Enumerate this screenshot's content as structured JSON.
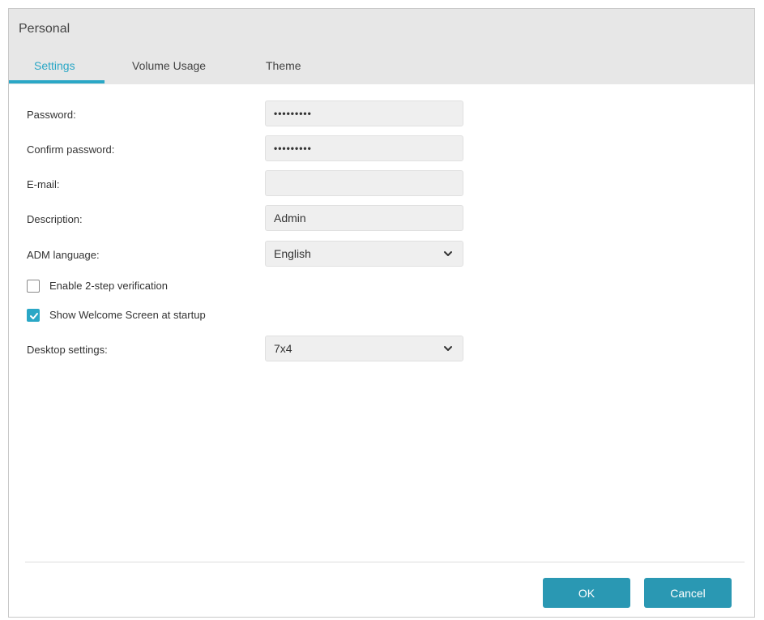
{
  "window": {
    "title": "Personal"
  },
  "tabs": [
    {
      "label": "Settings",
      "active": true
    },
    {
      "label": "Volume Usage",
      "active": false
    },
    {
      "label": "Theme",
      "active": false
    }
  ],
  "form": {
    "password": {
      "label": "Password:",
      "value": "•••••••••"
    },
    "confirm_password": {
      "label": "Confirm password:",
      "value": "•••••••••"
    },
    "email": {
      "label": "E-mail:",
      "value": ""
    },
    "description": {
      "label": "Description:",
      "value": "Admin"
    },
    "adm_language": {
      "label": "ADM language:",
      "value": "English"
    },
    "two_step": {
      "label": "Enable 2-step verification",
      "checked": false
    },
    "welcome_screen": {
      "label": "Show Welcome Screen at startup",
      "checked": true
    },
    "desktop_settings": {
      "label": "Desktop settings:",
      "value": "7x4"
    }
  },
  "buttons": {
    "ok": "OK",
    "cancel": "Cancel"
  },
  "colors": {
    "accent": "#2aa7c6",
    "button": "#2a98b3",
    "header_bg": "#e7e7e7"
  },
  "icons": {
    "dropdown": "chevron-down-icon",
    "checkmark": "check-icon"
  }
}
